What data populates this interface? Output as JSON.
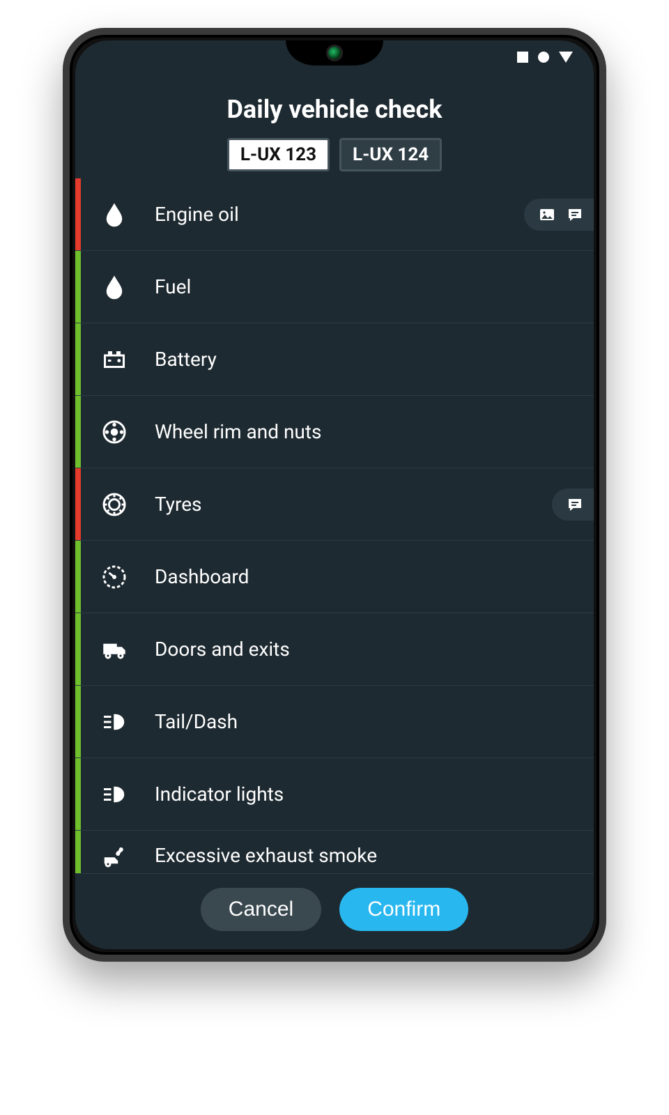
{
  "header": {
    "title": "Daily vehicle check"
  },
  "tabs": [
    {
      "id": "tab-0",
      "label": "L-UX 123",
      "active": true
    },
    {
      "id": "tab-1",
      "label": "L-UX 124",
      "active": false
    }
  ],
  "status_colors": {
    "ok": "#6fbf2d",
    "fail": "#e43b2c"
  },
  "items": [
    {
      "icon": "drop-icon",
      "label": "Engine oil",
      "status": "fail",
      "has_photo": true,
      "has_comment": true
    },
    {
      "icon": "drop-icon",
      "label": "Fuel",
      "status": "ok",
      "has_photo": false,
      "has_comment": false
    },
    {
      "icon": "battery-icon",
      "label": "Battery",
      "status": "ok",
      "has_photo": false,
      "has_comment": false
    },
    {
      "icon": "wheel-icon",
      "label": "Wheel rim and nuts",
      "status": "ok",
      "has_photo": false,
      "has_comment": false
    },
    {
      "icon": "tyre-icon",
      "label": "Tyres",
      "status": "fail",
      "has_photo": false,
      "has_comment": true
    },
    {
      "icon": "gauge-icon",
      "label": "Dashboard",
      "status": "ok",
      "has_photo": false,
      "has_comment": false
    },
    {
      "icon": "truck-icon",
      "label": "Doors and exits",
      "status": "ok",
      "has_photo": false,
      "has_comment": false
    },
    {
      "icon": "headlight-icon",
      "label": "Tail/Dash",
      "status": "ok",
      "has_photo": false,
      "has_comment": false
    },
    {
      "icon": "headlight-icon",
      "label": "Indicator lights",
      "status": "ok",
      "has_photo": false,
      "has_comment": false
    },
    {
      "icon": "exhaust-icon",
      "label": "Excessive exhaust smoke",
      "status": "ok",
      "has_photo": false,
      "has_comment": false
    }
  ],
  "footer": {
    "cancel_label": "Cancel",
    "confirm_label": "Confirm"
  },
  "icons": {
    "photo": "photo-icon",
    "comment": "comment-icon"
  }
}
